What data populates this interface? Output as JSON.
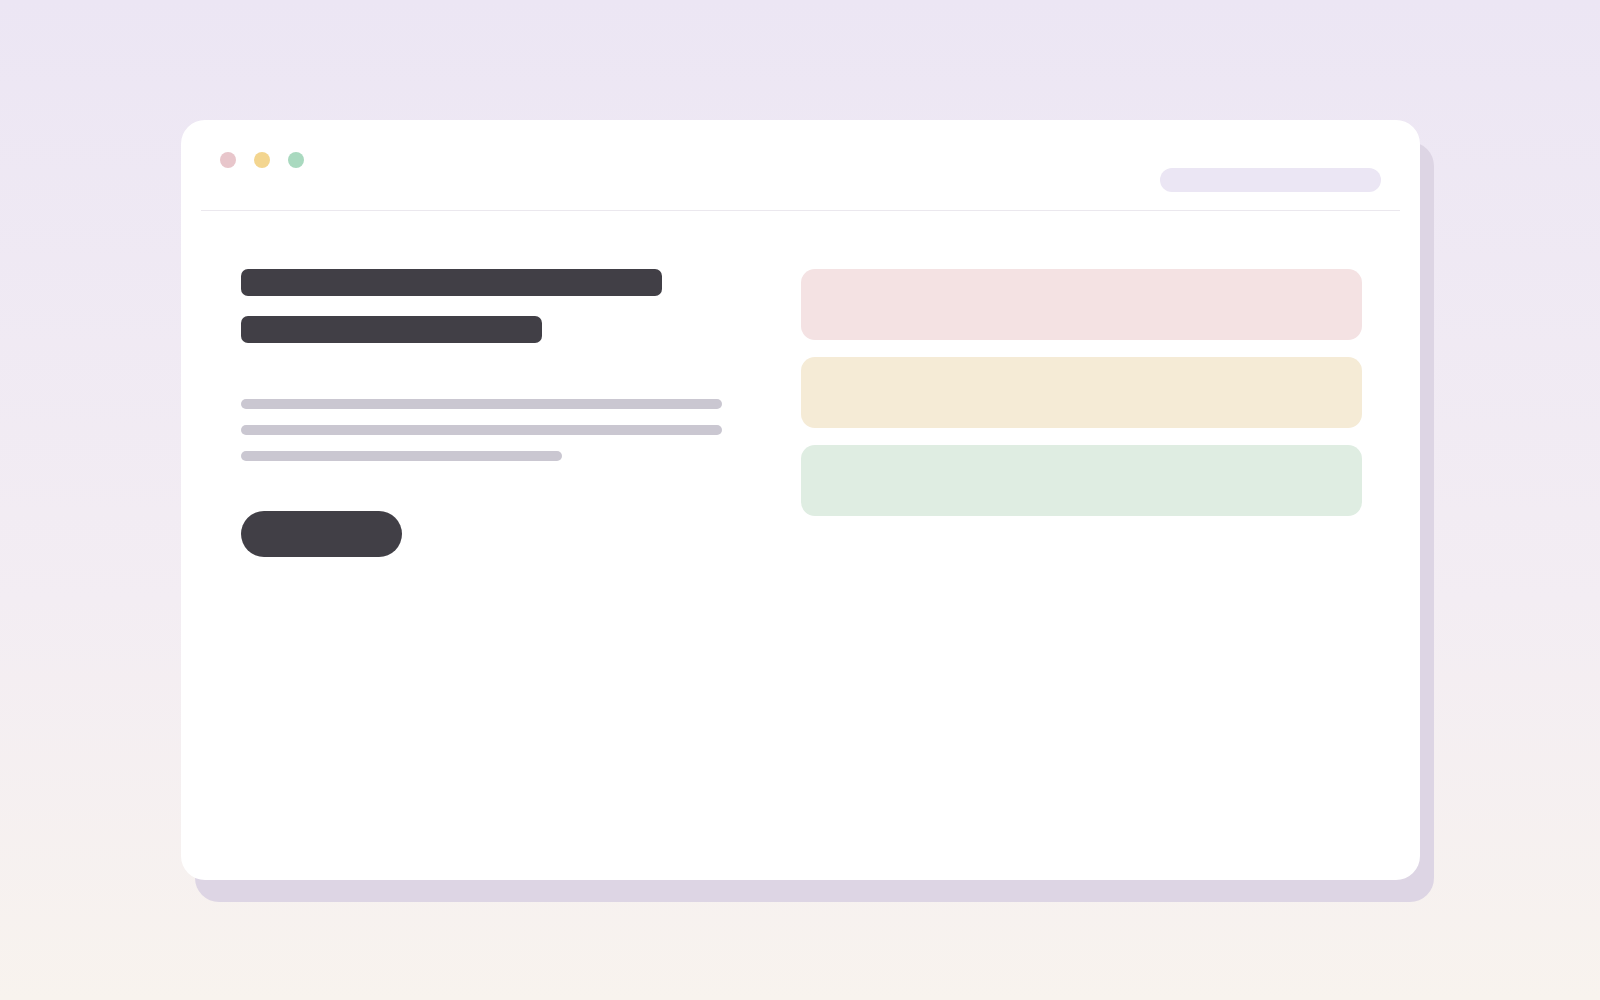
{
  "window_controls": [
    {
      "color": "#e8c6cb"
    },
    {
      "color": "#f3d58f"
    },
    {
      "color": "#a9d9bf"
    }
  ],
  "cards": [
    {
      "color": "#f4e2e3"
    },
    {
      "color": "#f5ebd6"
    },
    {
      "color": "#dfede2"
    }
  ]
}
